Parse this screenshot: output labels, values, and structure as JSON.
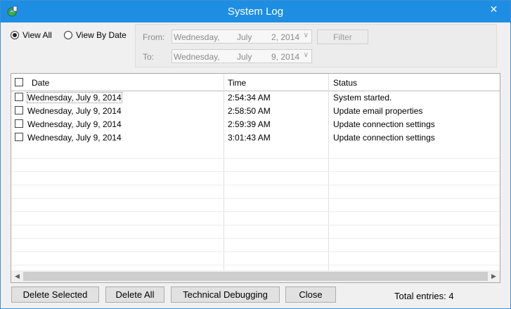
{
  "window": {
    "title": "System Log",
    "close_glyph": "✕"
  },
  "filters": {
    "view_all_label": "View All",
    "view_by_date_label": "View By Date",
    "selected": "View All",
    "from_label": "From:",
    "to_label": "To:",
    "from_date": {
      "weekday": "Wednesday,",
      "month": "July",
      "day_year": "2, 2014"
    },
    "to_date": {
      "weekday": "Wednesday,",
      "month": "July",
      "day_year": "9, 2014"
    },
    "filter_label": "Filter"
  },
  "log_table": {
    "columns": [
      "Date",
      "Time",
      "Status"
    ],
    "rows": [
      {
        "date": "Wednesday, July 9, 2014",
        "time": "2:54:34 AM",
        "status": "System started."
      },
      {
        "date": "Wednesday, July 9, 2014",
        "time": "2:58:50 AM",
        "status": "Update email properties"
      },
      {
        "date": "Wednesday, July 9, 2014",
        "time": "2:59:39 AM",
        "status": "Update connection settings"
      },
      {
        "date": "Wednesday, July 9, 2014",
        "time": "3:01:43 AM",
        "status": "Update connection settings"
      }
    ]
  },
  "actions": {
    "delete_selected": "Delete Selected",
    "delete_all": "Delete All",
    "technical_debugging": "Technical Debugging",
    "close": "Close"
  },
  "summary": {
    "total_entries": "Total entries: 4"
  },
  "icons": {
    "app": "log-app-icon",
    "dropdown": "chevron-down-icon"
  }
}
